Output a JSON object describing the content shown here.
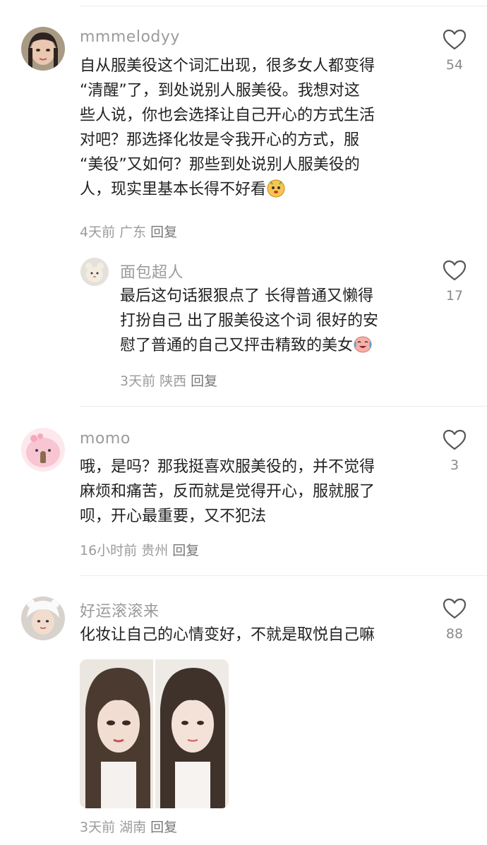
{
  "comments": [
    {
      "user": "mmmelodyy",
      "lines": [
        "自从服美役这个词汇出现，很多女人都变得",
        "“清醒”了，到处说别人服美役。我想对这",
        "些人说，你也会选择让自己开心的方式生活",
        "对吧？那选择化妆是令我开心的方式，服",
        "“美役”又如何？那些到处说别人服美役的",
        "人，现实里基本长得不好看"
      ],
      "emoji": "smirk-emoji",
      "time": "4天前",
      "location": "广东",
      "reply": "回复",
      "likes": "54"
    },
    {
      "user": "面包超人",
      "lines": [
        "最后这句话狠狠点了 长得普通又懒得",
        "打扮自己 出了服美役这个词 很好的安",
        "慰了普通的自己又抨击精致的美女"
      ],
      "emoji": "crying-laugh-emoji",
      "time": "3天前",
      "location": "陕西",
      "reply": "回复",
      "likes": "17"
    },
    {
      "user": "momo",
      "lines": [
        "哦，是吗？那我挺喜欢服美役的，并不觉得",
        "麻烦和痛苦，反而就是觉得开心，服就服了",
        "呗，开心最重要，又不犯法"
      ],
      "time": "16小时前",
      "location": "贵州",
      "reply": "回复",
      "likes": "3"
    },
    {
      "user": "好运滚滚来",
      "lines": [
        "化妆让自己的心情变好，不就是取悦自己嘛"
      ],
      "time": "3天前",
      "location": "湖南",
      "reply": "回复",
      "likes": "88"
    }
  ],
  "icons": {
    "like": "heart-outline-icon"
  },
  "colors": {
    "username": "#9b9b9b",
    "meta": "#9b9b9b",
    "text": "#222222",
    "divider": "#ececec"
  }
}
